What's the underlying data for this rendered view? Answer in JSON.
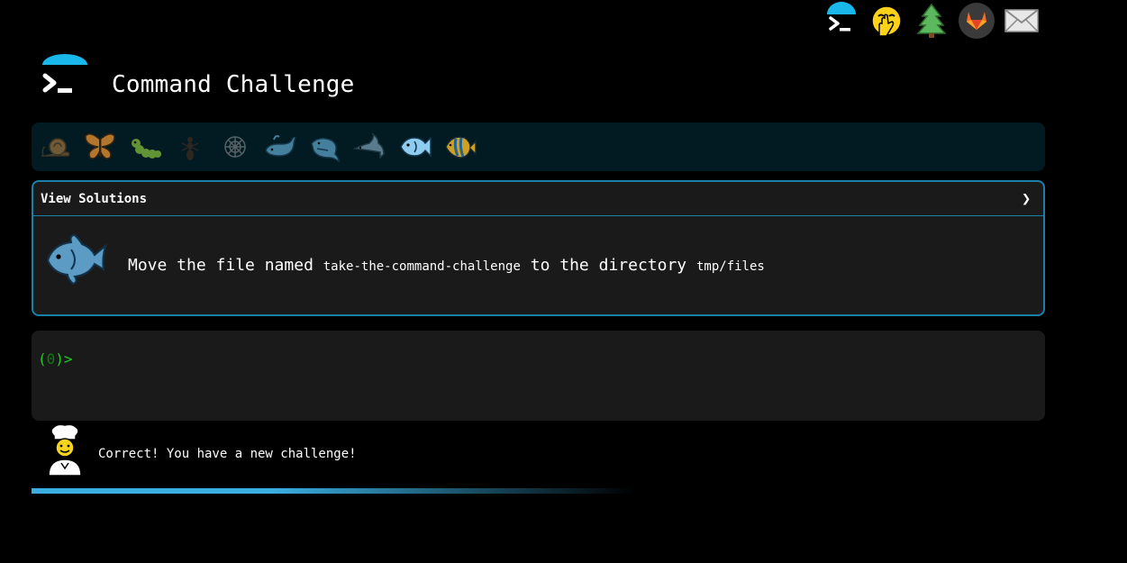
{
  "header": {
    "title": "Command Challenge",
    "logo_icon": "terminal-prompt-icon"
  },
  "nav_icons": [
    "terminal-prompt-icon",
    "face-with-hand-over-mouth-icon",
    "evergreen-tree-icon",
    "gitlab-fox-icon",
    "envelope-icon"
  ],
  "levels": [
    "snail-icon",
    "butterfly-icon",
    "caterpillar-icon",
    "ant-icon",
    "spider-web-icon",
    "whale-icon",
    "spouting-whale-icon",
    "dolphin-icon",
    "fish-icon",
    "tropical-fish-icon"
  ],
  "current_level_icon": "fish-icon",
  "challenge": {
    "view_solutions_label": "View Solutions",
    "chevron": "❯",
    "icon": "fish-icon",
    "text_before": "Move the file named ",
    "filename": "take-the-command-challenge",
    "text_middle": " to the directory ",
    "directory": "tmp/files"
  },
  "terminal": {
    "prompt_open": "(",
    "exit_code": "0",
    "prompt_close": ")>"
  },
  "feedback": {
    "icon": "cook-icon",
    "message": "Correct! You have a new challenge!"
  },
  "colors": {
    "background": "#000000",
    "panel": "#1a1a1a",
    "accent": "#1b7fa8",
    "level_bar": "#021a21",
    "prompt_green": "#22cc22",
    "progress": "#3aaee0"
  },
  "progress_fraction": 0.55
}
